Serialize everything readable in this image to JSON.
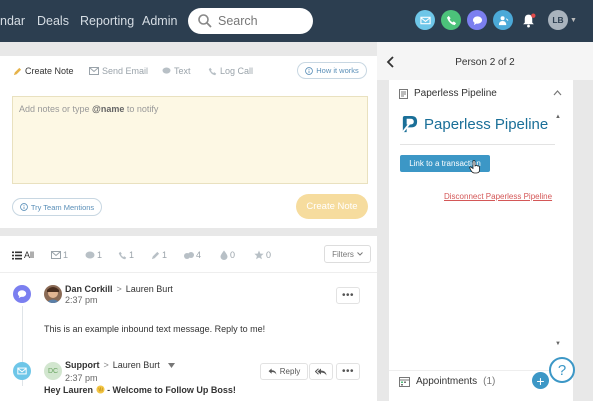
{
  "nav": {
    "items": [
      "ndar",
      "Deals",
      "Reporting",
      "Admin"
    ],
    "search_placeholder": "Search",
    "user_initials": "LB",
    "icon_colors": {
      "email": "#6ec6e8",
      "call": "#4cc27a",
      "text": "#7b7ff0",
      "agent": "#4ba9d8"
    }
  },
  "composer": {
    "tabs": [
      "Create Note",
      "Send Email",
      "Text",
      "Log Call"
    ],
    "how_it_works": "How it works",
    "placeholder_pre": "Add notes or type ",
    "placeholder_bold": "@name",
    "placeholder_post": " to notify",
    "team_mentions": "Try Team Mentions",
    "create_button": "Create Note"
  },
  "feed": {
    "filters": [
      {
        "label": "All",
        "icon": "list-icon"
      },
      {
        "label": "1",
        "icon": "email-icon"
      },
      {
        "label": "1",
        "icon": "text-icon"
      },
      {
        "label": "1",
        "icon": "call-icon"
      },
      {
        "label": "1",
        "icon": "pin-icon"
      },
      {
        "label": "4",
        "icon": "activity-icon"
      },
      {
        "label": "0",
        "icon": "drop-icon"
      },
      {
        "label": "0",
        "icon": "star-icon"
      }
    ],
    "filters_button": "Filters",
    "items": [
      {
        "from": "Dan Corkill",
        "to": "Lauren Burt",
        "time": "2:37 pm",
        "message": "This is an example inbound text message. Reply to me!"
      },
      {
        "avatar_initials": "DC",
        "from": "Support",
        "to": "Lauren Burt",
        "time": "2:37 pm",
        "reply": "Reply",
        "message": "Hey Lauren",
        "message_tail": " - Welcome to Follow Up Boss!"
      }
    ]
  },
  "person_panel": {
    "title": "Person 2 of 2",
    "integration_title": "Paperless Pipeline",
    "logo_text": "Paperless Pipeline",
    "link_button": "Link to a transaction",
    "disconnect": "Disconnect Paperless Pipeline",
    "appointments_label": "Appointments",
    "appointments_count": "(1)"
  },
  "help_label": "?",
  "colors": {
    "nav_bg": "#2c3e50",
    "accent_blue": "#3c97c6",
    "create_note_disabled": "#f6dc9e",
    "notes_bg": "#fdf8e4",
    "disconnect_red": "#d45757"
  }
}
